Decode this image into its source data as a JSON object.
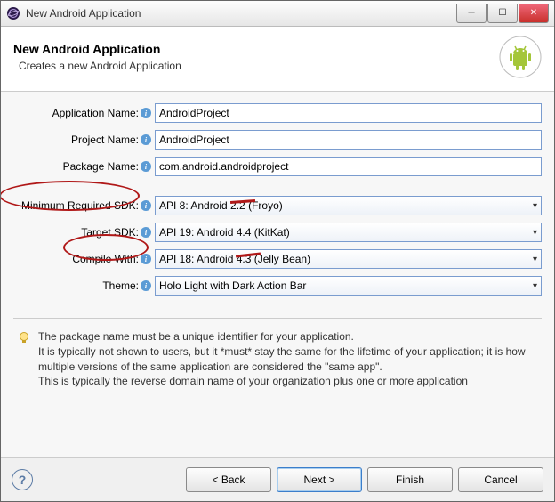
{
  "window": {
    "title": "New Android Application"
  },
  "header": {
    "title": "New Android Application",
    "subtitle": "Creates a new Android Application"
  },
  "form": {
    "app_name_label": "Application Name:",
    "app_name_value": "AndroidProject",
    "project_name_label": "Project Name:",
    "project_name_value": "AndroidProject",
    "package_name_label": "Package Name:",
    "package_name_value": "com.android.androidproject",
    "min_sdk_label": "Minimum Required SDK:",
    "min_sdk_value": "API 8: Android 2.2 (Froyo)",
    "target_sdk_label": "Target SDK:",
    "target_sdk_value": "API 19: Android 4.4 (KitKat)",
    "compile_with_label": "Compile With:",
    "compile_with_value": "API 18: Android 4.3 (Jelly Bean)",
    "theme_label": "Theme:",
    "theme_value": "Holo Light with Dark Action Bar"
  },
  "help": {
    "line1": "The package name must be a unique identifier for your application.",
    "line2": "It is typically not shown to users, but it *must* stay the same for the lifetime of your application; it is how multiple versions of the same application are considered the \"same app\".",
    "line3": "This is typically the reverse domain name of your organization plus one or more application"
  },
  "buttons": {
    "back": "< Back",
    "next": "Next >",
    "finish": "Finish",
    "cancel": "Cancel"
  }
}
